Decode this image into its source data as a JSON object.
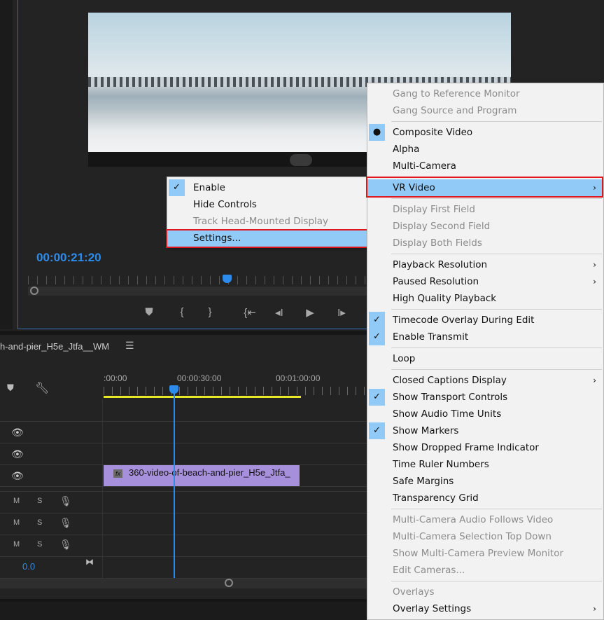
{
  "program_monitor": {
    "timecode": "00:00:21:20",
    "transport": [
      {
        "name": "add-marker",
        "glyph": "⛊"
      },
      {
        "name": "mark-in",
        "glyph": "{"
      },
      {
        "name": "mark-out",
        "glyph": "}"
      },
      {
        "name": "go-to-in",
        "glyph": "{⇤"
      },
      {
        "name": "step-back",
        "glyph": "◂I"
      },
      {
        "name": "play",
        "glyph": "▶"
      },
      {
        "name": "step-forward",
        "glyph": "I▸"
      }
    ]
  },
  "timeline": {
    "sequence_name": "h-and-pier_H5e_Jtfa__WM",
    "ruler_labels": [
      ":00:00",
      "00:00:30:00",
      "00:01:00:00"
    ],
    "clip_name": "360-video-of-beach-and-pier_H5e_Jtfa_",
    "clip_badge": "fx",
    "audio_tracks": [
      {
        "m": "M",
        "s": "S"
      },
      {
        "m": "M",
        "s": "S"
      },
      {
        "m": "M",
        "s": "S"
      }
    ],
    "master_volume": "0.0"
  },
  "vr_submenu": [
    {
      "label": "Enable",
      "check": "✓"
    },
    {
      "label": "Hide Controls"
    },
    {
      "label": "Track Head-Mounted Display",
      "disabled": true
    },
    {
      "label": "Settings...",
      "highlight": true
    }
  ],
  "context_menu": [
    {
      "label": "Gang to Reference Monitor",
      "disabled": true
    },
    {
      "label": "Gang Source and Program",
      "disabled": true
    },
    {
      "sep": true
    },
    {
      "label": "Composite Video",
      "check": "●"
    },
    {
      "label": "Alpha"
    },
    {
      "label": "Multi-Camera"
    },
    {
      "sep": true
    },
    {
      "label": "VR Video",
      "submenu": true,
      "highlight": true
    },
    {
      "sep": true
    },
    {
      "label": "Display First Field",
      "disabled": true
    },
    {
      "label": "Display Second Field",
      "disabled": true
    },
    {
      "label": "Display Both Fields",
      "disabled": true
    },
    {
      "sep": true
    },
    {
      "label": "Playback Resolution",
      "submenu": true
    },
    {
      "label": "Paused Resolution",
      "submenu": true
    },
    {
      "label": "High Quality Playback"
    },
    {
      "sep": true
    },
    {
      "label": "Timecode Overlay During Edit",
      "check": "✓"
    },
    {
      "label": "Enable Transmit",
      "check": "✓"
    },
    {
      "sep": true
    },
    {
      "label": "Loop"
    },
    {
      "sep": true
    },
    {
      "label": "Closed Captions Display",
      "submenu": true
    },
    {
      "label": "Show Transport Controls",
      "check": "✓"
    },
    {
      "label": "Show Audio Time Units"
    },
    {
      "label": "Show Markers",
      "check": "✓"
    },
    {
      "label": "Show Dropped Frame Indicator"
    },
    {
      "label": "Time Ruler Numbers"
    },
    {
      "label": "Safe Margins"
    },
    {
      "label": "Transparency Grid"
    },
    {
      "sep": true
    },
    {
      "label": "Multi-Camera Audio Follows Video",
      "disabled": true
    },
    {
      "label": "Multi-Camera Selection Top Down",
      "disabled": true
    },
    {
      "label": "Show Multi-Camera Preview Monitor",
      "disabled": true
    },
    {
      "label": "Edit Cameras...",
      "disabled": true
    },
    {
      "sep": true
    },
    {
      "label": "Overlays",
      "disabled": true
    },
    {
      "label": "Overlay Settings",
      "submenu": true
    }
  ],
  "colors": {
    "accent": "#2d8ceb",
    "highlight": "#91c9f7",
    "callout": "#e0161e",
    "clip": "#a68fdb",
    "work_area": "#e7e72a"
  }
}
